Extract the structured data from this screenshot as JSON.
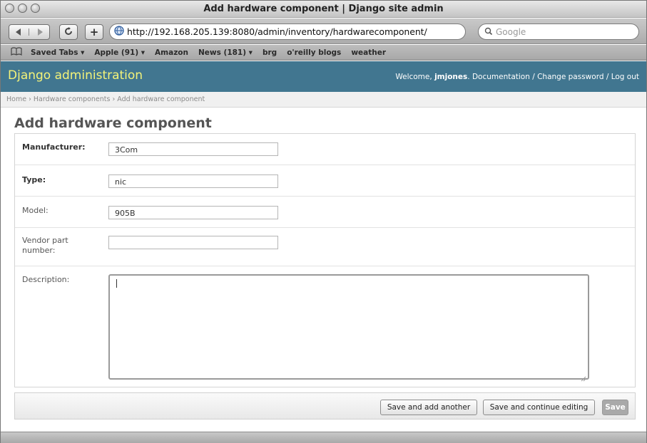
{
  "window": {
    "title": "Add hardware component | Django site admin"
  },
  "toolbar": {
    "url": "http://192.168.205.139:8080/admin/inventory/hardwarecomponent/",
    "search_placeholder": "Google",
    "add_label": "+"
  },
  "bookmarks": {
    "items": [
      "Saved Tabs ▾",
      "Apple (91) ▾",
      "Amazon",
      "News (181) ▾",
      "brg",
      "o'reilly blogs",
      "weather"
    ]
  },
  "header": {
    "brand": "Django administration",
    "welcome": "Welcome, ",
    "username": "jmjones",
    "links": ". Documentation / Change password / Log out"
  },
  "breadcrumbs": "Home › Hardware components › Add hardware component",
  "page_title": "Add hardware component",
  "form": {
    "manufacturer": {
      "label": "Manufacturer:",
      "value": "3Com"
    },
    "type": {
      "label": "Type:",
      "value": "nic"
    },
    "model": {
      "label": "Model:",
      "value": "905B"
    },
    "vendor_part": {
      "label": "Vendor part number:",
      "value": ""
    },
    "description": {
      "label": "Description:",
      "value": ""
    }
  },
  "buttons": {
    "save_add": "Save and add another",
    "save_continue": "Save and continue editing",
    "save": "Save"
  },
  "colors": {
    "header_bg": "#417690",
    "brand": "#f4f379"
  },
  "icons": [
    "back-arrow-icon",
    "forward-arrow-icon",
    "reload-icon",
    "site-icon",
    "search-icon",
    "bookmarks-book-icon",
    "resize-grip-icon"
  ]
}
